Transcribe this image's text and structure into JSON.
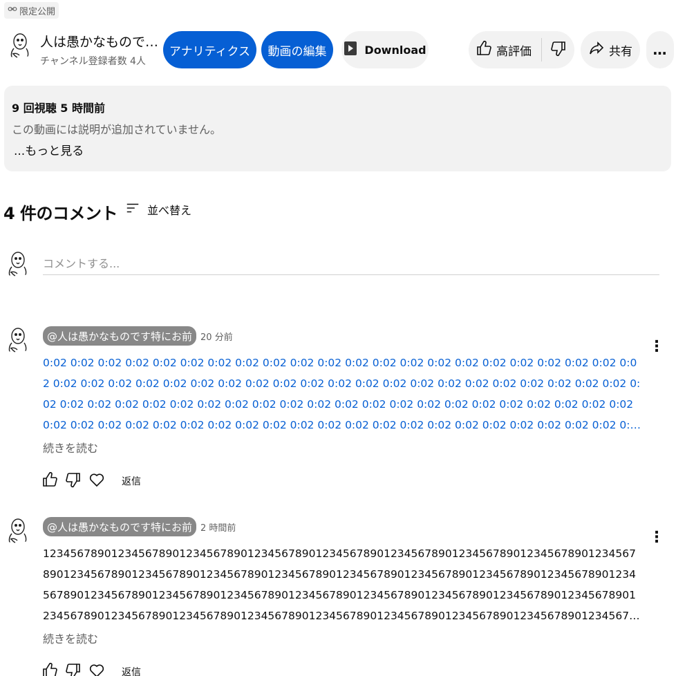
{
  "visibility": {
    "label": "限定公開"
  },
  "channel": {
    "title": "人は愚かなもので…",
    "subscribers": "チャンネル登録者数 4人"
  },
  "actions": {
    "analytics": "アナリティクス",
    "edit_video": "動画の編集",
    "download": "Download",
    "like": "高評価",
    "share": "共有",
    "more": "…"
  },
  "description": {
    "views": "9 回視聴",
    "time": "5 時間前",
    "text": "この動画には説明が追加されていません。",
    "more": "...もっと見る"
  },
  "comments_section": {
    "count": "4 件のコメント",
    "sort": "並べ替え",
    "add_placeholder": "コメントする..."
  },
  "comments": [
    {
      "author": "@人は愚かなものです特にお前",
      "time": "20 分前",
      "body": "0:02 0:02 0:02 0:02 0:02 0:02 0:02 0:02 0:02 0:02 0:02 0:02 0:02 0:02 0:02 0:02 0:02 0:02 0:02 0:02 0:02 0:02 0:02 0:02 0:02 0:02 0:02 0:02 0:02 0:02 0:02 0:02 0:02 0:02 0:02 0:02 0:02 0:02 0:02 0:02 0:02 0:02 0:02 0:02 0:02 0:02 0:02 0:02 0:02 0:02 0:02 0:02 0:02 0:02 0:02 0:02 0:02 0:02 0:02 0:02 0:02 0:02 0:02 0:02 0:02 0:02 0:02 0:02 0:02 0:02 0:02 0:02 0:02 0:02 0:02 0:02 0:02 0:02 0:02 0:02 0:02 0:02 0:02 0:02 0:02 0:02 0:02 0:02 0:02 0:02 0:02 0:02 0:02 0:02 0:02 0:02 0:02 0:02 0:02 0:02 0:02 0:02 0:02 0:02 0:02 0:02 0:02 0:02 0:02 0:02 0:02 0:02 ...",
      "read_more": "続きを読む",
      "reply": "返信"
    },
    {
      "author": "@人は愚かなものです特にお前",
      "time": "2 時間前",
      "body": "1234567890123456789012345678901234567890123456789012345678901234567890123456789012345678901234567890123456789012345678901234567890123456789012345678901234567890123456789012345678901234567890123456789012345678901234567890123456789012345678901234567890123456789012345678901234567890123456789012345678901234567890123456789012345678901234567890123456789012345678901234567...",
      "read_more": "続きを読む",
      "reply": "返信"
    }
  ],
  "colors": {
    "accent": "#065fd4",
    "chip_bg": "#f2f2f2",
    "author_chip": "#888888",
    "secondary_text": "#606060"
  },
  "icons": {
    "visibility": "link-icon",
    "download": "download-icon",
    "like": "thumbs-up-icon",
    "dislike": "thumbs-down-icon",
    "share": "share-icon",
    "sort": "sort-icon",
    "heart": "heart-icon",
    "more": "more-vertical-icon"
  }
}
